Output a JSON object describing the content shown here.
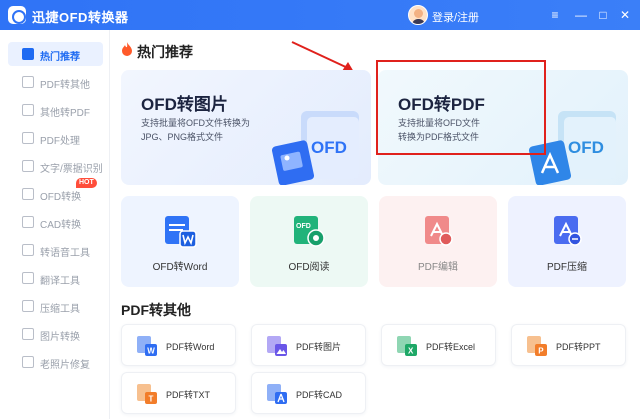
{
  "titlebar": {
    "app_title": "迅捷OFD转换器",
    "login_label": "登录/注册",
    "buttons": {
      "menu": "≡",
      "minimize": "—",
      "maximize": "□",
      "close": "✕"
    }
  },
  "sidebar": {
    "items": [
      {
        "label": "热门推荐",
        "icon": "fire-icon",
        "active": true
      },
      {
        "label": "PDF转其他",
        "icon": "pdf-icon"
      },
      {
        "label": "其他转PDF",
        "icon": "doc-icon"
      },
      {
        "label": "PDF处理",
        "icon": "pdf-process-icon"
      },
      {
        "label": "文字/票据识别",
        "icon": "ocr-icon"
      },
      {
        "label": "OFD转换",
        "icon": "ofd-icon",
        "badge": "HOT"
      },
      {
        "label": "CAD转换",
        "icon": "cad-icon"
      },
      {
        "label": "转语音工具",
        "icon": "voice-icon"
      },
      {
        "label": "翻译工具",
        "icon": "translate-icon"
      },
      {
        "label": "压缩工具",
        "icon": "compress-icon"
      },
      {
        "label": "图片转换",
        "icon": "image-icon"
      },
      {
        "label": "老照片修复",
        "icon": "photo-repair-icon"
      }
    ]
  },
  "hot": {
    "section_title": "热门推荐",
    "big_cards": [
      {
        "title": "OFD转图片",
        "desc_line1": "支持批量将OFD文件转换为",
        "desc_line2": "JPG、PNG格式文件",
        "art_text": "OFD"
      },
      {
        "title": "OFD转PDF",
        "desc_line1": "支持批量将OFD文件",
        "desc_line2": "转换为PDF格式文件",
        "art_text": "OFD"
      }
    ],
    "mid_cards": [
      {
        "label": "OFD转Word",
        "icon": "ofd-word-icon"
      },
      {
        "label": "OFD阅读",
        "icon": "ofd-read-icon",
        "icon_text": "OFD"
      },
      {
        "label": "PDF编辑",
        "icon": "pdf-edit-icon"
      },
      {
        "label": "PDF压缩",
        "icon": "pdf-compress-icon"
      }
    ]
  },
  "pdf_other": {
    "section_title": "PDF转其他",
    "tools": [
      {
        "label": "PDF转Word",
        "icon": "pdf-word-icon",
        "letter": "W"
      },
      {
        "label": "PDF转图片",
        "icon": "pdf-image-icon"
      },
      {
        "label": "PDF转Excel",
        "icon": "pdf-excel-icon",
        "letter": "X"
      },
      {
        "label": "PDF转PPT",
        "icon": "pdf-ppt-icon",
        "letter": "P"
      },
      {
        "label": "PDF转TXT",
        "icon": "pdf-txt-icon",
        "letter": "T"
      },
      {
        "label": "PDF转CAD",
        "icon": "pdf-cad-icon"
      }
    ]
  },
  "colors": {
    "brand": "#2f73f6",
    "highlight": "#e0211c",
    "hot": "#ff4d3a"
  }
}
